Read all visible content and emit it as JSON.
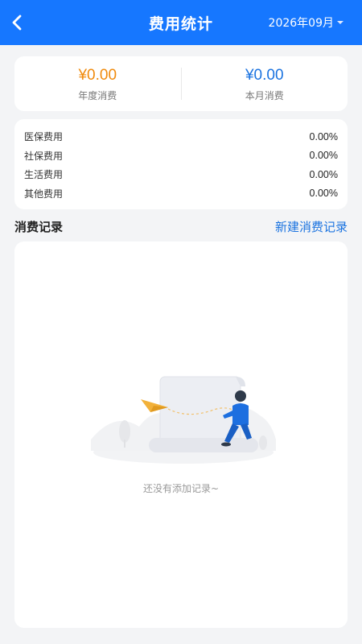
{
  "header": {
    "title": "费用统计",
    "date": "2026年09月",
    "icons": {
      "back": "back-chevron-icon",
      "date_dropdown": "dropdown-icon"
    }
  },
  "summary": {
    "yearly": {
      "amount": "¥0.00",
      "label": "年度消费",
      "color": "#f08a0c"
    },
    "monthly": {
      "amount": "¥0.00",
      "label": "本月消费",
      "color": "#1b73e0"
    }
  },
  "breakdown": [
    {
      "label": "医保费用",
      "percent": "0.00%"
    },
    {
      "label": "社保费用",
      "percent": "0.00%"
    },
    {
      "label": "生活费用",
      "percent": "0.00%"
    },
    {
      "label": "其他费用",
      "percent": "0.00%"
    }
  ],
  "records": {
    "section_title": "消费记录",
    "new_button": "新建消费记录",
    "empty_text": "还没有添加记录~",
    "empty_illustration": "empty-state-illustration"
  },
  "colors": {
    "primary": "#1677ff",
    "accent_orange": "#f08a0c",
    "link_blue": "#1b73e0",
    "background": "#f3f4f6"
  }
}
